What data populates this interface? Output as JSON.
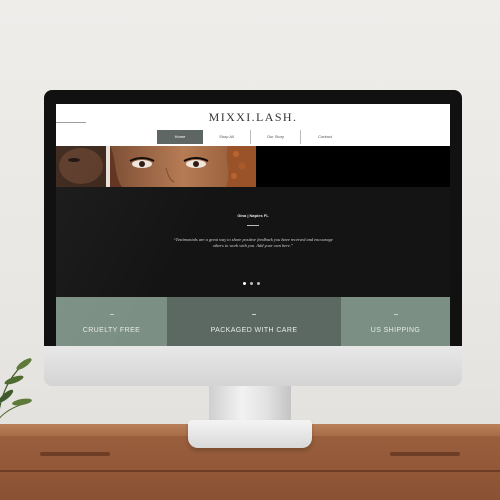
{
  "site": {
    "logo": "MIXXI.LASH.",
    "nav": [
      {
        "label": "Home",
        "active": true
      },
      {
        "label": "Shop All",
        "active": false
      },
      {
        "label": "Our Story",
        "active": false
      },
      {
        "label": "Contact",
        "active": false
      }
    ]
  },
  "testimonial": {
    "name": "Gina | Naples FL",
    "quote": "“Testimonials are a great way to share positive feedback you have received and encourage others to work with you. Add your own here.”",
    "slide_count": 3,
    "active_slide": 1
  },
  "features": [
    {
      "label": "CRUELTY FREE"
    },
    {
      "label": "PACKAGED WITH CARE"
    },
    {
      "label": "US SHIPPING"
    }
  ],
  "colors": {
    "nav_active_bg": "#5b6461",
    "feature_sage": "#7b8f84",
    "feature_dark_sage": "#5c6962",
    "testimonial_bg": "#141414",
    "desk_wood": "#9a5f3d"
  }
}
